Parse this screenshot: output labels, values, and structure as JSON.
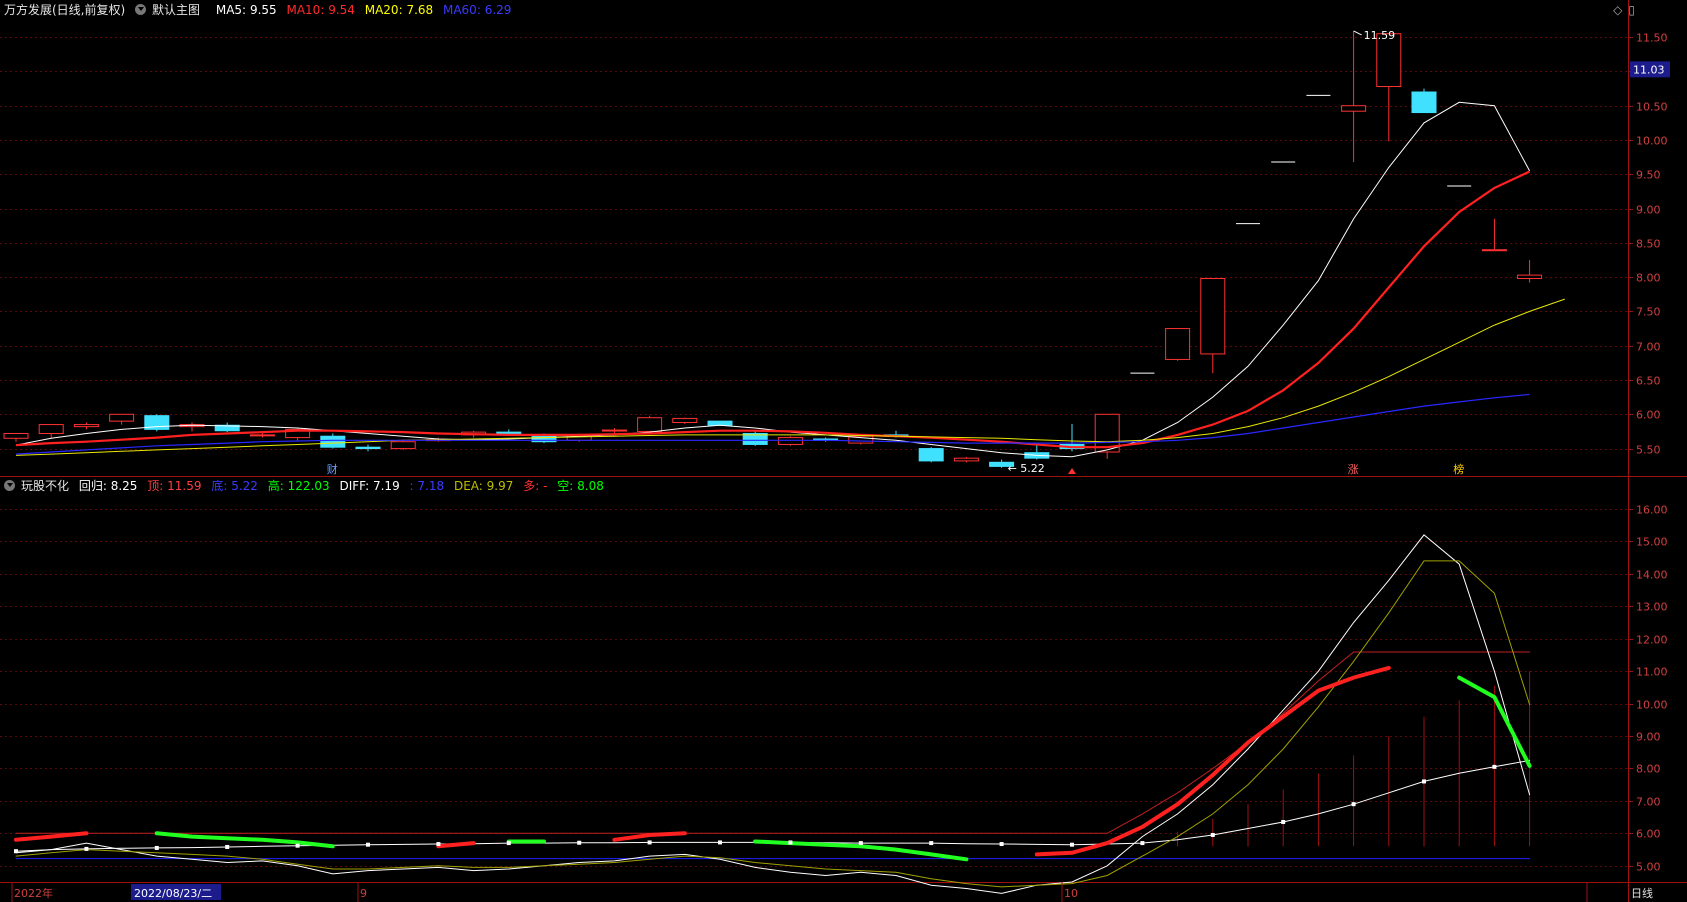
{
  "main_panel": {
    "stock_title": "万方发展(日线,前复权)",
    "template_name": "默认主图",
    "ma": [
      {
        "label": "MA5:",
        "value": "9.55",
        "color": "#ffffff"
      },
      {
        "label": "MA10:",
        "value": "9.54",
        "color": "#ff2a2a"
      },
      {
        "label": "MA20:",
        "value": "7.68",
        "color": "#ffff00"
      },
      {
        "label": "MA60:",
        "value": "6.29",
        "color": "#3030ff"
      }
    ],
    "current_price_badge": "11.03",
    "price_axis": [
      "11.50",
      "11.00",
      "10.50",
      "10.00",
      "9.50",
      "9.00",
      "8.50",
      "8.00",
      "7.50",
      "7.00",
      "6.50",
      "6.00",
      "5.50"
    ],
    "high_label": "11.59",
    "low_label": "5.22",
    "markers": [
      {
        "text": "财",
        "color": "#6aa0ff"
      },
      {
        "text": "涨",
        "color": "#ff6060"
      },
      {
        "text": "榜",
        "color": "#ffcc00"
      }
    ],
    "ipo_marker_color": "#ff3030"
  },
  "indicator_panel": {
    "name": "玩股不化",
    "values": [
      {
        "label": "回归:",
        "value": "8.25",
        "color": "#ffffff"
      },
      {
        "label": "顶:",
        "value": "11.59",
        "color": "#ff4040"
      },
      {
        "label": "底:",
        "value": "5.22",
        "color": "#3030ff"
      },
      {
        "label": "高:",
        "value": "122.03",
        "color": "#00ff00"
      },
      {
        "label": "DIFF:",
        "value": "7.19",
        "color": "#ffffff"
      },
      {
        "label": ":",
        "value": "7.18",
        "color": "#3030ff"
      },
      {
        "label": "DEA:",
        "value": "9.97",
        "color": "#bdbd00"
      },
      {
        "label": "多:",
        "value": "-",
        "color": "#ff3030"
      },
      {
        "label": "空:",
        "value": "8.08",
        "color": "#00ff00"
      }
    ],
    "axis": [
      "16.00",
      "15.00",
      "14.00",
      "13.00",
      "12.00",
      "11.00",
      "10.00",
      "9.00",
      "8.00",
      "7.00",
      "6.00",
      "5.00"
    ]
  },
  "time_axis": {
    "labels": [
      "2022年",
      "9",
      "10"
    ],
    "cursor_date": "2022/08/23/二",
    "period": "日线"
  },
  "chart_data": [
    {
      "type": "candlestick",
      "title": "万方发展(日线,前复权)",
      "ylim": [
        5.1,
        11.75
      ],
      "candles": [
        {
          "o": 5.65,
          "h": 5.72,
          "l": 5.6,
          "c": 5.72
        },
        {
          "o": 5.72,
          "h": 5.85,
          "l": 5.65,
          "c": 5.85
        },
        {
          "o": 5.82,
          "h": 5.88,
          "l": 5.78,
          "c": 5.85
        },
        {
          "o": 5.9,
          "h": 6.0,
          "l": 5.85,
          "c": 6.0
        },
        {
          "o": 5.98,
          "h": 6.0,
          "l": 5.75,
          "c": 5.78
        },
        {
          "o": 5.82,
          "h": 5.88,
          "l": 5.75,
          "c": 5.85
        },
        {
          "o": 5.84,
          "h": 5.88,
          "l": 5.74,
          "c": 5.76
        },
        {
          "o": 5.7,
          "h": 5.74,
          "l": 5.66,
          "c": 5.7
        },
        {
          "o": 5.66,
          "h": 5.8,
          "l": 5.62,
          "c": 5.78
        },
        {
          "o": 5.68,
          "h": 5.72,
          "l": 5.5,
          "c": 5.52
        },
        {
          "o": 5.52,
          "h": 5.56,
          "l": 5.46,
          "c": 5.5
        },
        {
          "o": 5.5,
          "h": 5.62,
          "l": 5.48,
          "c": 5.6
        },
        {
          "o": 5.62,
          "h": 5.66,
          "l": 5.6,
          "c": 5.63
        },
        {
          "o": 5.7,
          "h": 5.76,
          "l": 5.66,
          "c": 5.74
        },
        {
          "o": 5.74,
          "h": 5.78,
          "l": 5.7,
          "c": 5.72
        },
        {
          "o": 5.7,
          "h": 5.72,
          "l": 5.58,
          "c": 5.6
        },
        {
          "o": 5.62,
          "h": 5.72,
          "l": 5.6,
          "c": 5.7
        },
        {
          "o": 5.76,
          "h": 5.8,
          "l": 5.72,
          "c": 5.77
        },
        {
          "o": 5.75,
          "h": 5.98,
          "l": 5.72,
          "c": 5.95
        },
        {
          "o": 5.88,
          "h": 5.95,
          "l": 5.86,
          "c": 5.94
        },
        {
          "o": 5.9,
          "h": 5.9,
          "l": 5.84,
          "c": 5.84
        },
        {
          "o": 5.72,
          "h": 5.76,
          "l": 5.54,
          "c": 5.56
        },
        {
          "o": 5.56,
          "h": 5.68,
          "l": 5.54,
          "c": 5.66
        },
        {
          "o": 5.64,
          "h": 5.66,
          "l": 5.6,
          "c": 5.62
        },
        {
          "o": 5.58,
          "h": 5.7,
          "l": 5.56,
          "c": 5.68
        },
        {
          "o": 5.7,
          "h": 5.76,
          "l": 5.66,
          "c": 5.68
        },
        {
          "o": 5.5,
          "h": 5.52,
          "l": 5.3,
          "c": 5.32
        },
        {
          "o": 5.32,
          "h": 5.38,
          "l": 5.3,
          "c": 5.36
        },
        {
          "o": 5.3,
          "h": 5.34,
          "l": 5.22,
          "c": 5.24
        },
        {
          "o": 5.44,
          "h": 5.58,
          "l": 5.34,
          "c": 5.36
        },
        {
          "o": 5.56,
          "h": 5.86,
          "l": 5.46,
          "c": 5.5
        },
        {
          "o": 5.45,
          "h": 6.0,
          "l": 5.35,
          "c": 6.0
        },
        {
          "o": 6.6,
          "h": 6.6,
          "l": 6.6,
          "c": 6.6
        },
        {
          "o": 6.8,
          "h": 7.25,
          "l": 6.78,
          "c": 7.25
        },
        {
          "o": 6.88,
          "h": 7.98,
          "l": 6.6,
          "c": 7.98
        },
        {
          "o": 8.78,
          "h": 8.78,
          "l": 8.78,
          "c": 8.78
        },
        {
          "o": 9.68,
          "h": 9.68,
          "l": 9.68,
          "c": 9.68
        },
        {
          "o": 10.65,
          "h": 10.65,
          "l": 10.65,
          "c": 10.65
        },
        {
          "o": 10.42,
          "h": 11.59,
          "l": 9.68,
          "c": 10.5
        },
        {
          "o": 10.78,
          "h": 11.55,
          "l": 9.98,
          "c": 11.55
        },
        {
          "o": 10.7,
          "h": 10.75,
          "l": 10.4,
          "c": 10.4
        },
        {
          "o": 9.33,
          "h": 9.33,
          "l": 9.33,
          "c": 9.33
        },
        {
          "o": 8.4,
          "h": 8.85,
          "l": 8.4,
          "c": 8.4
        },
        {
          "o": 7.98,
          "h": 8.25,
          "l": 7.92,
          "c": 8.03
        }
      ],
      "series": [
        {
          "name": "MA5",
          "values": [
            5.55,
            5.65,
            5.72,
            5.78,
            5.82,
            5.84,
            5.83,
            5.82,
            5.8,
            5.76,
            5.72,
            5.68,
            5.64,
            5.63,
            5.64,
            5.66,
            5.68,
            5.7,
            5.74,
            5.8,
            5.84,
            5.8,
            5.74,
            5.7,
            5.66,
            5.62,
            5.56,
            5.5,
            5.44,
            5.4,
            5.38,
            5.48,
            5.62,
            5.88,
            6.25,
            6.7,
            7.3,
            7.95,
            8.85,
            9.6,
            10.25,
            10.55,
            10.5,
            9.55
          ]
        },
        {
          "name": "MA10",
          "values": [
            5.55,
            5.58,
            5.6,
            5.63,
            5.66,
            5.7,
            5.72,
            5.74,
            5.76,
            5.76,
            5.75,
            5.74,
            5.72,
            5.71,
            5.7,
            5.7,
            5.7,
            5.71,
            5.72,
            5.74,
            5.76,
            5.76,
            5.75,
            5.73,
            5.7,
            5.68,
            5.66,
            5.63,
            5.6,
            5.56,
            5.52,
            5.52,
            5.58,
            5.7,
            5.85,
            6.05,
            6.35,
            6.75,
            7.25,
            7.85,
            8.45,
            8.95,
            9.3,
            9.54
          ]
        },
        {
          "name": "MA20",
          "values": [
            5.4,
            5.42,
            5.44,
            5.46,
            5.48,
            5.5,
            5.52,
            5.54,
            5.56,
            5.58,
            5.6,
            5.62,
            5.63,
            5.64,
            5.65,
            5.66,
            5.67,
            5.68,
            5.69,
            5.7,
            5.7,
            5.7,
            5.7,
            5.7,
            5.69,
            5.68,
            5.67,
            5.66,
            5.65,
            5.63,
            5.61,
            5.6,
            5.62,
            5.66,
            5.72,
            5.82,
            5.95,
            6.12,
            6.32,
            6.55,
            6.8,
            7.05,
            7.3,
            7.5,
            7.68
          ]
        },
        {
          "name": "MA60",
          "values": [
            5.42,
            5.45,
            5.48,
            5.51,
            5.54,
            5.56,
            5.58,
            5.6,
            5.61,
            5.62,
            5.62,
            5.62,
            5.62,
            5.62,
            5.62,
            5.62,
            5.62,
            5.62,
            5.62,
            5.62,
            5.62,
            5.62,
            5.62,
            5.62,
            5.61,
            5.6,
            5.59,
            5.58,
            5.58,
            5.58,
            5.58,
            5.59,
            5.6,
            5.62,
            5.66,
            5.72,
            5.8,
            5.88,
            5.96,
            6.04,
            6.12,
            6.18,
            6.24,
            6.29
          ]
        }
      ]
    },
    {
      "type": "line",
      "title": "玩股不化",
      "ylim": [
        4.5,
        16.4
      ],
      "series": [
        {
          "name": "回归",
          "values": [
            5.45,
            5.5,
            5.52,
            5.54,
            5.55,
            5.56,
            5.58,
            5.6,
            5.62,
            5.63,
            5.65,
            5.66,
            5.67,
            5.68,
            5.7,
            5.7,
            5.71,
            5.71,
            5.72,
            5.72,
            5.72,
            5.72,
            5.72,
            5.71,
            5.7,
            5.7,
            5.7,
            5.68,
            5.67,
            5.66,
            5.65,
            5.67,
            5.7,
            5.8,
            5.95,
            6.15,
            6.35,
            6.6,
            6.9,
            7.25,
            7.6,
            7.85,
            8.05,
            8.25
          ]
        },
        {
          "name": "顶",
          "values": [
            6.0,
            6.0,
            6.0,
            6.0,
            6.0,
            6.0,
            6.0,
            6.0,
            6.0,
            6.0,
            6.0,
            6.0,
            6.0,
            6.0,
            6.0,
            6.0,
            6.0,
            6.0,
            6.0,
            6.0,
            6.0,
            6.0,
            6.0,
            6.0,
            6.0,
            6.0,
            6.0,
            6.0,
            6.0,
            6.0,
            6.0,
            6.0,
            6.6,
            7.25,
            8.0,
            8.8,
            9.7,
            10.7,
            11.59,
            11.59,
            11.59,
            11.59,
            11.59,
            11.59
          ]
        },
        {
          "name": "底",
          "values": [
            5.22,
            5.22,
            5.22,
            5.22,
            5.22,
            5.22,
            5.22,
            5.22,
            5.22,
            5.22,
            5.22,
            5.22,
            5.22,
            5.22,
            5.22,
            5.22,
            5.22,
            5.22,
            5.22,
            5.22,
            5.22,
            5.22,
            5.22,
            5.22,
            5.22,
            5.22,
            5.22,
            5.22,
            5.22,
            5.22,
            5.22,
            5.22,
            5.22,
            5.22,
            5.22,
            5.22,
            5.22,
            5.22,
            5.22,
            5.22,
            5.22,
            5.22,
            5.22,
            5.22
          ]
        },
        {
          "name": "DIFF",
          "values": [
            5.4,
            5.5,
            5.7,
            5.5,
            5.3,
            5.2,
            5.1,
            5.15,
            5.0,
            4.75,
            4.85,
            4.9,
            4.95,
            4.85,
            4.9,
            5.0,
            5.1,
            5.15,
            5.3,
            5.35,
            5.2,
            4.95,
            4.8,
            4.7,
            4.8,
            4.7,
            4.4,
            4.3,
            4.15,
            4.4,
            4.5,
            5.0,
            5.9,
            6.6,
            7.5,
            8.6,
            9.8,
            11.0,
            12.5,
            13.8,
            15.2,
            14.3,
            11.0,
            7.19
          ]
        },
        {
          "name": "DEA",
          "values": [
            5.3,
            5.4,
            5.5,
            5.45,
            5.4,
            5.35,
            5.3,
            5.2,
            5.05,
            4.9,
            4.9,
            4.95,
            5.0,
            4.95,
            4.95,
            5.0,
            5.05,
            5.1,
            5.2,
            5.3,
            5.25,
            5.1,
            5.0,
            4.9,
            4.85,
            4.8,
            4.6,
            4.45,
            4.35,
            4.4,
            4.45,
            4.7,
            5.3,
            5.9,
            6.6,
            7.5,
            8.6,
            9.9,
            11.3,
            12.8,
            14.4,
            14.4,
            13.4,
            9.97
          ]
        },
        {
          "name": "多",
          "values": [
            5.8,
            5.9,
            6.0,
            null,
            null,
            null,
            null,
            null,
            null,
            null,
            null,
            null,
            5.6,
            5.7,
            null,
            null,
            null,
            5.8,
            5.95,
            6.0,
            null,
            null,
            null,
            null,
            null,
            null,
            null,
            null,
            null,
            5.35,
            5.4,
            5.7,
            6.2,
            6.9,
            7.8,
            8.8,
            9.6,
            10.4,
            10.8,
            11.1,
            null,
            null,
            null,
            null
          ]
        },
        {
          "name": "空",
          "values": [
            null,
            null,
            null,
            null,
            6.0,
            5.9,
            5.85,
            5.8,
            5.72,
            5.6,
            null,
            null,
            null,
            null,
            5.75,
            5.75,
            null,
            null,
            null,
            null,
            null,
            5.75,
            5.7,
            5.65,
            5.6,
            5.5,
            5.35,
            5.2,
            null,
            null,
            null,
            null,
            null,
            null,
            null,
            null,
            null,
            null,
            null,
            null,
            null,
            10.8,
            10.2,
            8.08
          ]
        }
      ]
    }
  ]
}
